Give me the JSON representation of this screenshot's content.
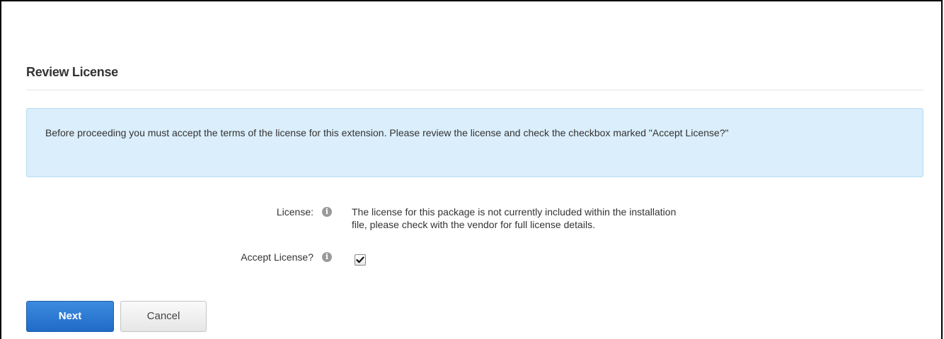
{
  "page": {
    "title": "Review License"
  },
  "notice": {
    "text": "Before proceeding you must accept the terms of the license for this extension. Please review the license and check the checkbox marked \"Accept License?\""
  },
  "form": {
    "license_label": "License:",
    "license_text_line1": "The license for this package is not currently included within the installation",
    "license_text_line2": "file, please check with the vendor for full license details.",
    "accept_label": "Accept License?",
    "accept_checked": true,
    "help_icon_glyph": "i"
  },
  "buttons": {
    "next_label": "Next",
    "cancel_label": "Cancel"
  },
  "colors": {
    "notice_background": "#daeefb",
    "primary_button": "#2a78d4"
  }
}
